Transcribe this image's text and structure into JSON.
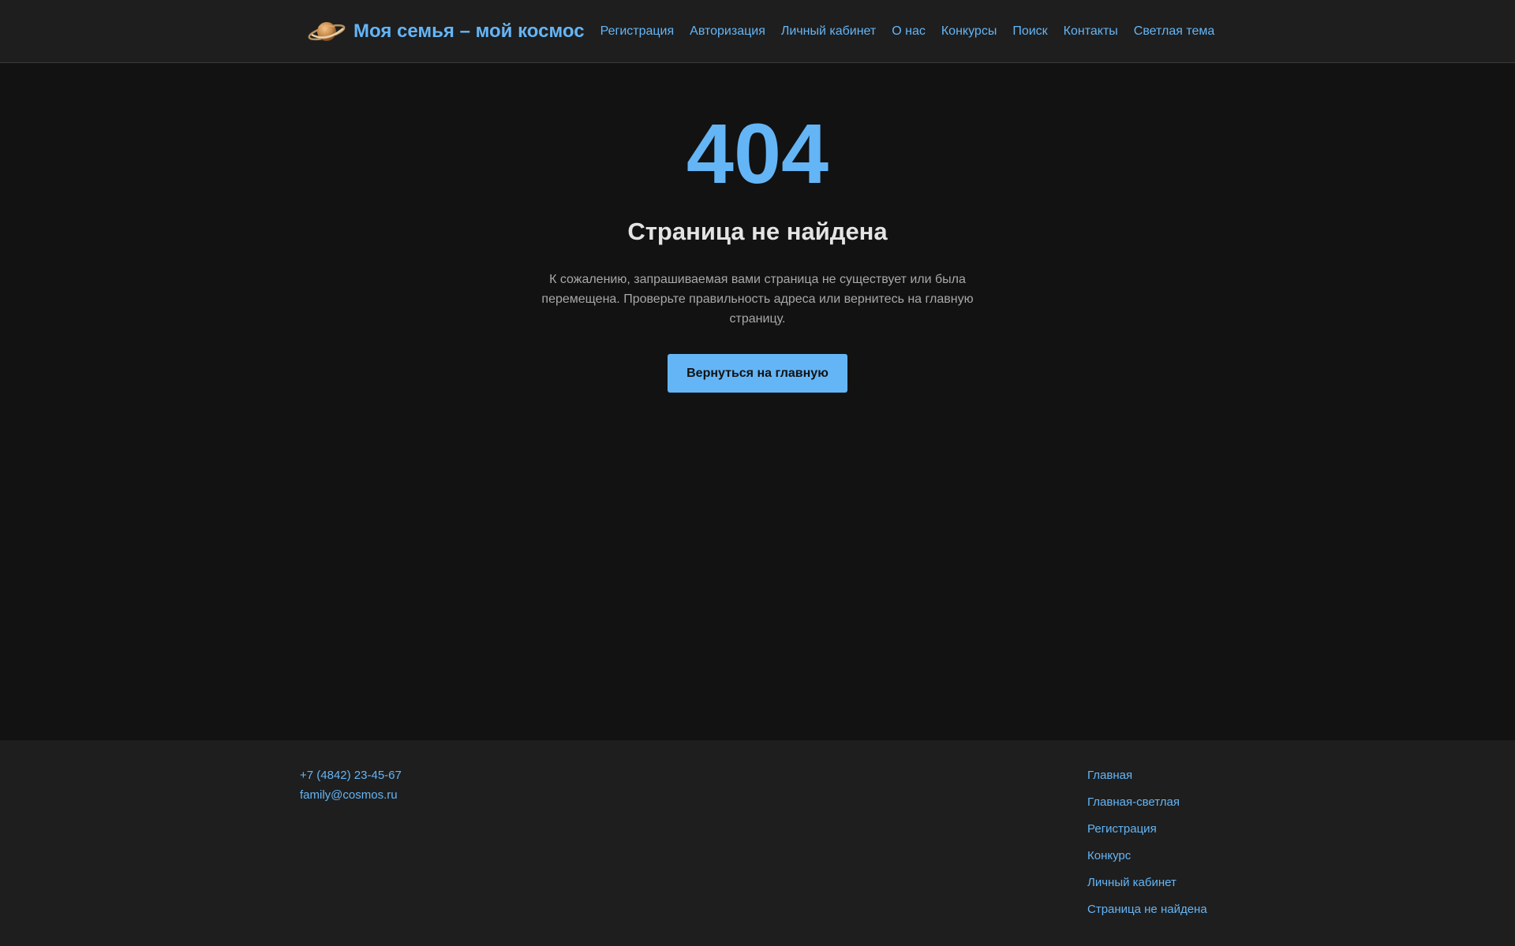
{
  "header": {
    "logo_text": "Моя семья – мой космос",
    "logo_icon": "planet-icon",
    "nav": [
      {
        "label": "Регистрация"
      },
      {
        "label": "Авторизация"
      },
      {
        "label": "Личный кабинет"
      },
      {
        "label": "О нас"
      },
      {
        "label": "Конкурсы"
      },
      {
        "label": "Поиск"
      },
      {
        "label": "Контакты"
      },
      {
        "label": "Светлая тема"
      }
    ]
  },
  "main": {
    "code": "404",
    "title": "Страница не найдена",
    "message": "К сожалению, запрашиваемая вами страница не существует или была перемещена. Проверьте правильность адреса или вернитесь на главную страницу.",
    "button_label": "Вернуться на главную"
  },
  "footer": {
    "phone": "+7 (4842) 23-45-67",
    "email": "family@cosmos.ru",
    "links": [
      {
        "label": "Главная"
      },
      {
        "label": "Главная-светлая"
      },
      {
        "label": "Регистрация"
      },
      {
        "label": "Конкурс"
      },
      {
        "label": "Личный кабинет"
      },
      {
        "label": "Страница не найдена"
      }
    ]
  },
  "colors": {
    "accent": "#64b5f6",
    "background": "#121212",
    "surface": "#1e1e1e",
    "heading": "#e4e4e4",
    "muted_text": "#a8a8a8"
  }
}
